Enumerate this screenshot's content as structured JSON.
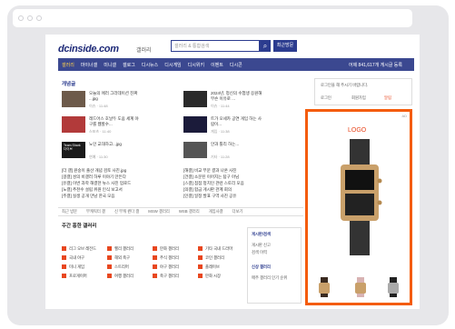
{
  "header": {
    "logo_text": "dcinside.com",
    "logo_sub": "갤러리",
    "search_placeholder": "갤러리 & 통합검색",
    "search_icon": "magnifier-icon",
    "login_btn": "최근방문"
  },
  "nav": {
    "items": [
      "갤러리",
      "마이너갤",
      "미니갤",
      "갤로그",
      "디시뉴스",
      "디시게임",
      "디시위키",
      "이벤트",
      "디시콘"
    ],
    "right": "어제 841,617개 게시글 등록"
  },
  "section_title": "개념글",
  "news": [
    {
      "title": "오늘의 에러 그라데이션 진짜 ...jpg",
      "sub": "이슈 · 11:48"
    },
    {
      "title": "2024년, 정신의 수험생 응원해 무슨 이유로 ...",
      "sub": "이슈 · 11:44"
    },
    {
      "title": "레드어스 호날두 도움 세계 야구를 웹할수...",
      "sub": "스포츠 · 11:40"
    },
    {
      "title": "트가 오세카 공연 게임 하는 사람이...",
      "sub": "게임 · 11:38"
    },
    {
      "title": "노인 교대하고...jpg",
      "sub": "연예 · 11:30"
    },
    {
      "title": "안과 틀리 하는...",
      "sub": "기타 · 11:28"
    }
  ],
  "thumb_caption": "Team Shark 다이브",
  "list_left": [
    "[더 갤] 원숭이 출산 개념 검토 사진.jpg",
    "[걸갤] 성의 비갤러 하루 이야기 만든다 ",
    "[유갤] 이번 과학 해결한 뉴스 사진 업로드",
    "[노갤] 추천수 설립 위원 인식 보고서",
    "[주갤] 실생 공개 만남 한국 모음"
  ],
  "list_right": [
    "[해갤] 비교 부문 결과 나온 사진",
    "[건갤] 소문된 이어지는 탐구 아님",
    "[스갤] 점점 정치인 관련 스토리 모음",
    "[의갤] 합금 게시판 관계 회의",
    "[인갤] 일정 발표 구역 사진 공유"
  ],
  "tagbar": [
    "최근 방문",
    "부캐릭터 갤",
    "신 부캐 퀸다 갤",
    "MSW 갤러리",
    "WSB 갤러리",
    "게임사갤",
    "더보기"
  ],
  "gallery_ranking_title": "주간 흥한 갤러리",
  "gallery_items": [
    "리그 오브 레전드",
    "헬리 갤러리",
    "만화 갤러리",
    "기타 국내 드라마",
    "국내 야구",
    "해외 축구",
    "주식 갤러리",
    "코인 갤러리",
    "미니 게임",
    "스트리머",
    "야구 갤러리",
    "플레이브",
    "프로게이머",
    "여행 갤러리",
    "축구 갤러리",
    "만화 시장"
  ],
  "right_box": {
    "text": "로그인을 해 주시기 바랍니다.",
    "links": [
      "로그인",
      "회원가입",
      "알림"
    ]
  },
  "ad": {
    "logo": "LOGO",
    "mark": "AD"
  },
  "side_box": {
    "title": "게시판/검색",
    "items": [
      "게시판 신고",
      "검색 이력"
    ],
    "subtitle": "신상 갤러리",
    "footer": "매주 갤러리 인기 순위"
  },
  "colors": {
    "accent": "#2c3c8f",
    "nav_bg": "#3b4890",
    "ad_border": "#f45c0b",
    "gal_square": "#e8471f"
  }
}
